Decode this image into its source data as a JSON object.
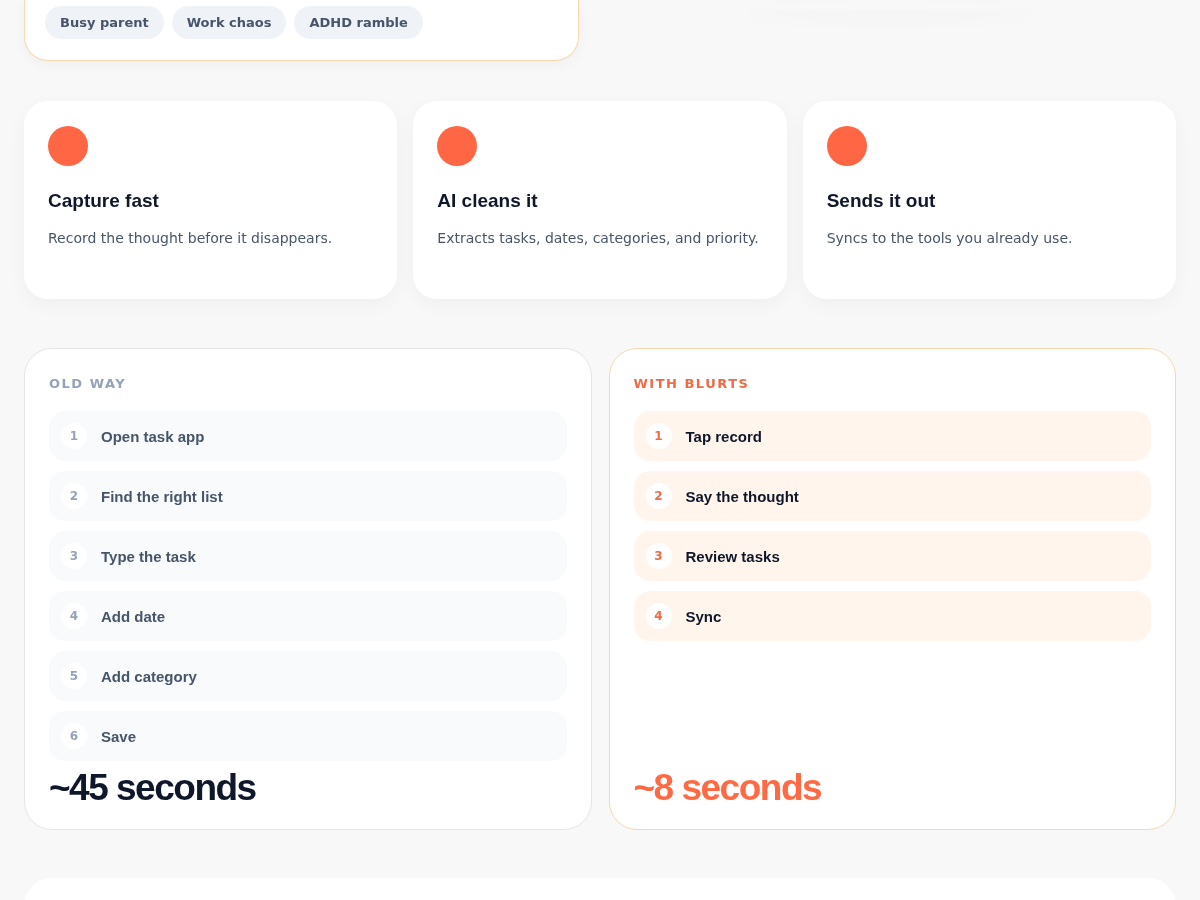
{
  "examples": {
    "tags": [
      "Busy parent",
      "Work chaos",
      "ADHD ramble"
    ]
  },
  "features": [
    {
      "title": "Capture fast",
      "text": "Record the thought before it disappears."
    },
    {
      "title": "AI cleans it",
      "text": "Extracts tasks, dates, categories, and priority."
    },
    {
      "title": "Sends it out",
      "text": "Syncs to the tools you already use."
    }
  ],
  "comparison": [
    {
      "kind": "old",
      "label": "OLD WAY",
      "steps": [
        {
          "number": "1",
          "text": "Open task app"
        },
        {
          "number": "2",
          "text": "Find the right list"
        },
        {
          "number": "3",
          "text": "Type the task"
        },
        {
          "number": "4",
          "text": "Add date"
        },
        {
          "number": "5",
          "text": "Add category"
        },
        {
          "number": "6",
          "text": "Save"
        }
      ],
      "total": "~45 seconds"
    },
    {
      "kind": "new",
      "label": "WITH BLURTS",
      "steps": [
        {
          "number": "1",
          "text": "Tap record"
        },
        {
          "number": "2",
          "text": "Say the thought"
        },
        {
          "number": "3",
          "text": "Review tasks"
        },
        {
          "number": "4",
          "text": "Sync"
        }
      ],
      "total": "~8 seconds"
    }
  ]
}
